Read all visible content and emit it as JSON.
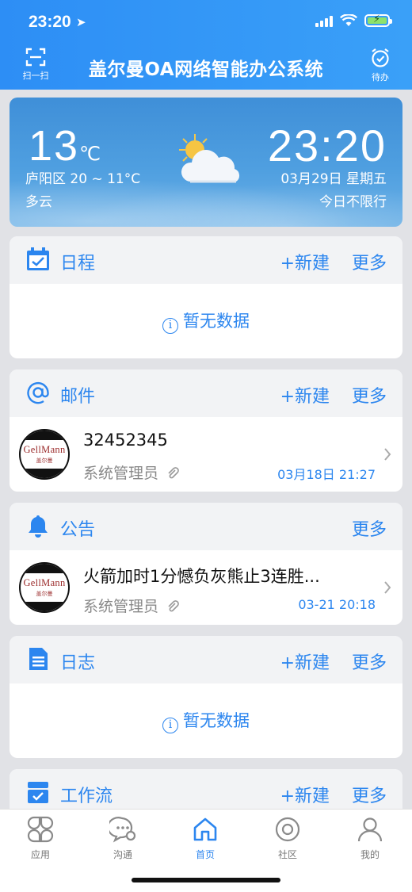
{
  "status": {
    "time": "23:20"
  },
  "header": {
    "scan_label": "扫一扫",
    "title": "盖尔曼OA网络智能办公系统",
    "todo_label": "待办"
  },
  "weather": {
    "temp": "13",
    "unit": "℃",
    "range": "庐阳区 20 ~ 11°C",
    "condition": "多云",
    "time": "23:20",
    "date": "03月29日 星期五",
    "limit": "今日不限行"
  },
  "schedule": {
    "title": "日程",
    "new": "+新建",
    "more": "更多",
    "empty": "暂无数据"
  },
  "mail": {
    "title": "邮件",
    "new": "+新建",
    "more": "更多",
    "item": {
      "logo_text": "GellMann",
      "logo_sub": "盖尔曼",
      "subject": "32452345",
      "sender": "系统管理员",
      "date": "03月18日 21:27"
    }
  },
  "notice": {
    "title": "公告",
    "more": "更多",
    "item": {
      "logo_text": "GellMann",
      "logo_sub": "盖尔曼",
      "subject": "火箭加时1分憾负灰熊止3连胜...",
      "sender": "系统管理员",
      "date": "03-21 20:18"
    }
  },
  "log": {
    "title": "日志",
    "new": "+新建",
    "more": "更多",
    "empty": "暂无数据"
  },
  "workflow": {
    "title": "工作流",
    "new": "+新建",
    "more": "更多"
  },
  "tabs": [
    {
      "label": "应用"
    },
    {
      "label": "沟通"
    },
    {
      "label": "首页"
    },
    {
      "label": "社区"
    },
    {
      "label": "我的"
    }
  ],
  "colors": {
    "accent": "#2c86ef",
    "header": "#3aa0f8",
    "background": "#e1e2e6"
  }
}
